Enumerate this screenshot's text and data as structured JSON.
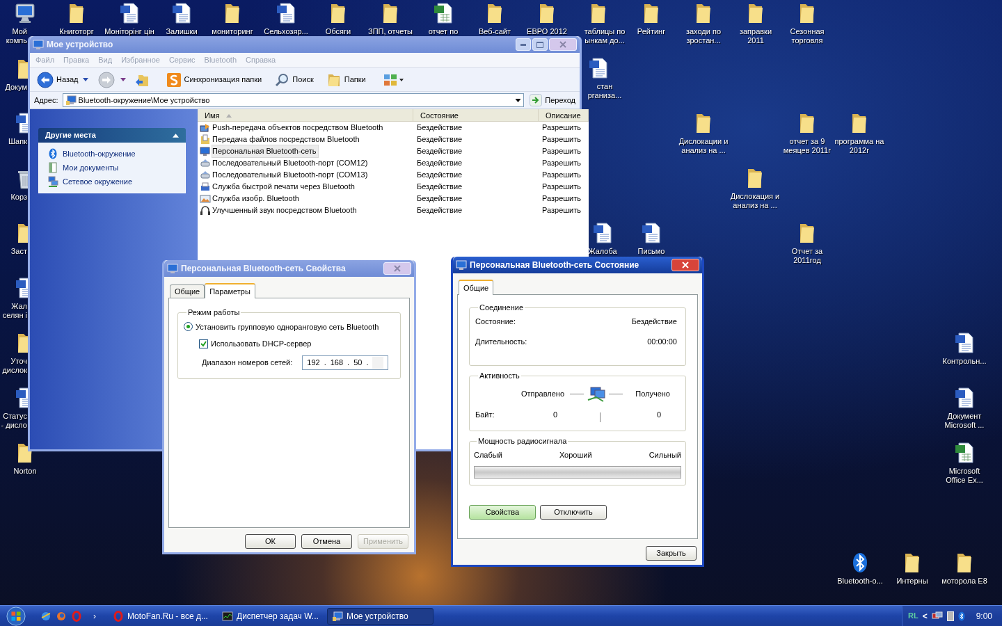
{
  "desktop": {
    "icons": [
      {
        "kind": "computer",
        "label": [
          "Мой",
          "компь"
        ]
      },
      {
        "kind": "folder",
        "label": [
          "Книготорг"
        ]
      },
      {
        "kind": "word",
        "label": [
          "Моніторінг цін"
        ]
      },
      {
        "kind": "word",
        "label": [
          "Залишки"
        ]
      },
      {
        "kind": "folder",
        "label": [
          "мониторинг"
        ]
      },
      {
        "kind": "word",
        "label": [
          "Сельхозяр..."
        ]
      },
      {
        "kind": "folder",
        "label": [
          "Обсяги"
        ]
      },
      {
        "kind": "folder",
        "label": [
          "ЗПП, отчеты"
        ]
      },
      {
        "kind": "excel",
        "label": [
          "отчет по"
        ]
      },
      {
        "kind": "folder",
        "label": [
          "Веб-сайт"
        ]
      },
      {
        "kind": "folder",
        "label": [
          "ЕВРО 2012"
        ]
      },
      {
        "kind": "folder",
        "label": [
          "таблицы по",
          "ынкам до..."
        ]
      },
      {
        "kind": "folder",
        "label": [
          "Рейтинг"
        ]
      },
      {
        "kind": "folder",
        "label": [
          "заходи по",
          "зростан..."
        ]
      },
      {
        "kind": "folder",
        "label": [
          "заправки",
          "2011"
        ]
      },
      {
        "kind": "folder",
        "label": [
          "Сезонная",
          "торговля"
        ]
      },
      {
        "kind": "folder",
        "label": [
          "Докум"
        ]
      },
      {
        "kind": "word",
        "label": [
          "Шапк"
        ]
      },
      {
        "kind": "bin",
        "label": [
          "Корз"
        ]
      },
      {
        "kind": "folder",
        "label": [
          "Заст"
        ]
      },
      {
        "kind": "word",
        "label": [
          "Жал",
          "селян і"
        ]
      },
      {
        "kind": "folder",
        "label": [
          "Уточ",
          "дислок"
        ]
      },
      {
        "kind": "word",
        "label": [
          "Статус",
          "- дисло"
        ]
      },
      {
        "kind": "folder",
        "label": [
          "Norton"
        ]
      },
      {
        "kind": "word",
        "label": [
          "стан",
          "рганиза..."
        ]
      },
      {
        "kind": "folder",
        "label": [
          "Дислокации и",
          "анализ на ..."
        ]
      },
      {
        "kind": "folder",
        "label": [
          "отчет за 9",
          "меяцев  2011г"
        ]
      },
      {
        "kind": "folder",
        "label": [
          "программа на",
          "2012г"
        ]
      },
      {
        "kind": "folder",
        "label": [
          "Дислокация и",
          "анализ на ..."
        ]
      },
      {
        "kind": "word",
        "label": [
          "Жалоба"
        ]
      },
      {
        "kind": "word",
        "label": [
          "Письмо"
        ]
      },
      {
        "kind": "folder",
        "label": [
          "Отчет за",
          "2011год"
        ]
      },
      {
        "kind": "word",
        "label": [
          "Контрольн..."
        ]
      },
      {
        "kind": "word",
        "label": [
          "Документ",
          "Microsoft ..."
        ]
      },
      {
        "kind": "excel",
        "label": [
          "Microsoft",
          "Office Ex..."
        ]
      },
      {
        "kind": "bluetooth",
        "label": [
          "Bluetooth-o..."
        ]
      },
      {
        "kind": "folder",
        "label": [
          "Интерны"
        ]
      },
      {
        "kind": "folder",
        "label": [
          "моторола E8"
        ]
      }
    ]
  },
  "explorer": {
    "title": "Мое устройство",
    "active": false,
    "menu": [
      "Файл",
      "Правка",
      "Вид",
      "Избранное",
      "Сервис",
      "Bluetooth",
      "Справка"
    ],
    "toolbar": {
      "back": "Назад",
      "sync": "Синхронизация папки",
      "search": "Поиск",
      "folders": "Папки"
    },
    "address": {
      "label": "Адрес:",
      "value": "Bluetooth-окружение\\Мое устройство",
      "go": "Переход"
    },
    "side_panel": {
      "title": "Другие места",
      "expanded": true,
      "items": [
        {
          "kind": "bluetooth",
          "label": "Bluetooth-окружение"
        },
        {
          "kind": "documents",
          "label": "Мои документы"
        },
        {
          "kind": "network",
          "label": "Сетевое окружение"
        }
      ]
    },
    "columns": [
      {
        "label": "Имя",
        "sorted": true
      },
      {
        "label": "Состояние",
        "sorted": false
      },
      {
        "label": "Описание",
        "sorted": false
      }
    ],
    "rows": [
      {
        "kind": "push",
        "name": "Push-передача объектов посредством Bluetooth",
        "status": "Бездействие",
        "description": "Разрешить",
        "selected": false
      },
      {
        "kind": "files",
        "name": "Передача файлов посредством Bluetooth",
        "status": "Бездействие",
        "description": "Разрешить",
        "selected": false
      },
      {
        "kind": "network",
        "name": "Персональная Bluetooth-сеть",
        "status": "Бездействие",
        "description": "Разрешить",
        "selected": true
      },
      {
        "kind": "serial",
        "name": "Последовательный Bluetooth-порт (COM12)",
        "status": "Бездействие",
        "description": "Разрешить",
        "selected": false
      },
      {
        "kind": "serial",
        "name": "Последовательный Bluetooth-порт (COM13)",
        "status": "Бездействие",
        "description": "Разрешить",
        "selected": false
      },
      {
        "kind": "print",
        "name": "Служба быстрой печати через Bluetooth",
        "status": "Бездействие",
        "description": "Разрешить",
        "selected": false
      },
      {
        "kind": "imaging",
        "name": "Служба изобр. Bluetooth",
        "status": "Бездействие",
        "description": "Разрешить",
        "selected": false
      },
      {
        "kind": "audio",
        "name": "Улучшенный звук посредством Bluetooth",
        "status": "Бездействие",
        "description": "Разрешить",
        "selected": false
      }
    ]
  },
  "properties_dialog": {
    "title": "Персональная Bluetooth-сеть Свойства",
    "active": false,
    "tabs": [
      {
        "label": "Общие",
        "selected": false
      },
      {
        "label": "Параметры",
        "selected": true
      }
    ],
    "group": "Режим работы",
    "radio": {
      "label": "Установить групповую одноранговую сеть Bluetooth",
      "checked": true
    },
    "checkbox": {
      "label": "Использовать DHCP-сервер",
      "checked": true
    },
    "range": {
      "label": "Диапазон номеров сетей:",
      "octets": [
        "192",
        "168",
        "50"
      ],
      "separator": "."
    },
    "buttons": [
      {
        "label": "ОК",
        "disabled": false
      },
      {
        "label": "Отмена",
        "disabled": false
      },
      {
        "label": "Применить",
        "disabled": true
      }
    ]
  },
  "status_dialog": {
    "title": "Персональная Bluetooth-сеть Состояние",
    "active": true,
    "tabs": [
      {
        "label": "Общие",
        "selected": true
      }
    ],
    "connection": {
      "title": "Соединение",
      "rows": [
        {
          "label": "Состояние:",
          "value": "Бездействие"
        },
        {
          "label": "Длительность:",
          "value": "00:00:00"
        }
      ]
    },
    "activity": {
      "title": "Активность",
      "sent": "Отправлено",
      "received": "Получено",
      "bytes_label": "Байт:",
      "bytes_sent": "0",
      "bytes_received": "0"
    },
    "signal": {
      "title": "Мощность радиосигнала",
      "scale": [
        "Слабый",
        "Хороший",
        "Сильный"
      ],
      "level": 0
    },
    "buttons": [
      {
        "label": "Свойства",
        "default": true
      },
      {
        "label": "Отключить",
        "default": false
      }
    ],
    "close_button": "Закрыть"
  },
  "taskbar": {
    "quick_launch_more": "›",
    "tasks": [
      {
        "kind": "browser",
        "label": "MotoFan.Ru - все д...",
        "selected": false
      },
      {
        "kind": "taskmanager",
        "label": "Диспетчер задач W...",
        "selected": false
      },
      {
        "kind": "explorer",
        "label": "Мое устройство",
        "selected": true
      }
    ],
    "tray": {
      "language": "RL",
      "expand": "<",
      "clock": "9:00"
    }
  }
}
